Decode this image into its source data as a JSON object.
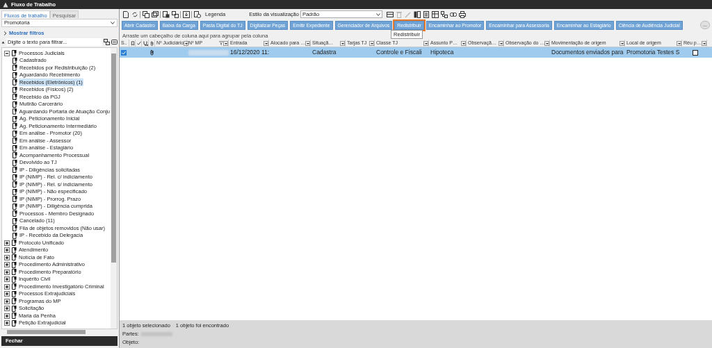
{
  "window": {
    "title": "Fluxo de Trabalho"
  },
  "left_panel": {
    "tabs": [
      {
        "label": "Fluxos de trabalho",
        "selected": true
      },
      {
        "label": "Pesquisar",
        "selected": false
      }
    ],
    "flow_select": {
      "value": "Promotoria"
    },
    "filters_toggle": {
      "label": "Mostrar filtros",
      "expanded": false
    },
    "filter_field": {
      "placeholder": "Digite o texto para filtrar..."
    },
    "tree": [
      {
        "label": "Processos Judiciais",
        "expanded": true,
        "selected": false,
        "children": [
          {
            "label": "Cadastrado",
            "selected": false
          },
          {
            "label": "Recebidos por Redistribuição (2)",
            "selected": false
          },
          {
            "label": "Aguardando Recebimento",
            "selected": false
          },
          {
            "label": "Recebidos (Eletrônicos) (1)",
            "selected": true
          },
          {
            "label": "Recebidos (Físicos) (2)",
            "selected": false
          },
          {
            "label": "Recebido da PGJ",
            "selected": false
          },
          {
            "label": "Mutirão Carcerário",
            "selected": false
          },
          {
            "label": "Aguardando Portaria de Atuação Conju",
            "selected": false
          },
          {
            "label": "Ag. Peticionamento Inicial",
            "selected": false
          },
          {
            "label": "Ag. Peticionamento Intermediário",
            "selected": false
          },
          {
            "label": "Em análise - Promotor (20)",
            "selected": false
          },
          {
            "label": "Em análise - Assessor",
            "selected": false
          },
          {
            "label": "Em análise - Estagiário",
            "selected": false
          },
          {
            "label": "Acompanhamento Processual",
            "selected": false
          },
          {
            "label": "Devolvido ao TJ",
            "selected": false
          },
          {
            "label": "IP - Diligências solicitadas",
            "selected": false
          },
          {
            "label": "IP (NIMP) - Rel. c/ indiciamento",
            "selected": false
          },
          {
            "label": "IP (NIMP) - Rel. s/ indiciamento",
            "selected": false
          },
          {
            "label": "IP (NIMP) - Não especificado",
            "selected": false
          },
          {
            "label": "IP (NIMP) - Prorrog. Prazo",
            "selected": false
          },
          {
            "label": "IP (NIMP) - Diligência cumprida",
            "selected": false
          },
          {
            "label": "Processos - Membro Designado",
            "selected": false
          },
          {
            "label": "Cancelado (11)",
            "selected": false
          },
          {
            "label": "Fila de objetos removidos (Não usar)",
            "selected": false
          },
          {
            "label": "IP - Recebido da Delegacia",
            "selected": false
          }
        ]
      },
      {
        "label": "Protocolo Unificado",
        "expanded": false,
        "selected": false
      },
      {
        "label": "Atendimento",
        "expanded": false,
        "selected": false
      },
      {
        "label": "Notícia de Fato",
        "expanded": false,
        "selected": false
      },
      {
        "label": "Procedimento Administrativo",
        "expanded": false,
        "selected": false
      },
      {
        "label": "Procedimento Preparatório",
        "expanded": false,
        "selected": false
      },
      {
        "label": "Inquérito Civil",
        "expanded": false,
        "selected": false
      },
      {
        "label": "Procedimento Investigatório Criminal",
        "expanded": false,
        "selected": false
      },
      {
        "label": "Processos Extrajudiciais",
        "expanded": false,
        "selected": false
      },
      {
        "label": "Programas do MP",
        "expanded": false,
        "selected": false
      },
      {
        "label": "Solicitação",
        "expanded": false,
        "selected": false
      },
      {
        "label": "Maria da Penha",
        "expanded": false,
        "selected": false
      },
      {
        "label": "Petição Extrajudicial",
        "expanded": false,
        "selected": false
      }
    ],
    "close_button": "Fechar"
  },
  "toolbar": {
    "legend_label": "Legenda",
    "view_style_label": "Estilo da visualização",
    "view_style": {
      "value": "Padrão"
    },
    "right_tools": [
      {
        "kind": "layout",
        "disabled": false
      },
      {
        "kind": "delete",
        "disabled": true
      },
      {
        "kind": "edit",
        "disabled": true
      },
      {
        "kind": "columns",
        "disabled": false
      },
      {
        "kind": "doc",
        "disabled": false
      },
      {
        "kind": "grid",
        "disabled": false
      },
      {
        "kind": "tree",
        "disabled": false
      },
      {
        "kind": "link",
        "disabled": false
      },
      {
        "kind": "print",
        "disabled": false
      }
    ]
  },
  "actions": [
    {
      "label": "Abrir Cadastro",
      "focused": false
    },
    {
      "label": "Baixa da Carga",
      "focused": false
    },
    {
      "label": "Pasta Digital do TJ",
      "focused": false
    },
    {
      "label": "Digitalizar Peças",
      "focused": false
    },
    {
      "label": "Emitir Expediente",
      "focused": false
    },
    {
      "label": "Gerenciador de Arquivos",
      "focused": false
    },
    {
      "label": "Redistribuir",
      "focused": true
    },
    {
      "label": "Encaminhar ao Promotor",
      "focused": false
    },
    {
      "label": "Encaminhar para Assessoria",
      "focused": false
    },
    {
      "label": "Encaminhar ao Estagiário",
      "focused": false
    },
    {
      "label": "Ciência de Audiência Judicial",
      "focused": false
    }
  ],
  "more_button": "...",
  "tooltip": "Redistribuir",
  "group_hint": "Arraste um cabeçalho de coluna aqui para agrupar pela coluna",
  "table": {
    "columns": [
      {
        "kind": "text",
        "label": "S.."
      },
      {
        "kind": "bookmark"
      },
      {
        "kind": "check"
      },
      {
        "kind": "stethoscope"
      },
      {
        "kind": "clip"
      },
      {
        "kind": "text",
        "label": "Nº Judiciário"
      },
      {
        "kind": "text",
        "label": "Nº MP",
        "filtered": true
      },
      {
        "kind": "text",
        "label": "Entrada"
      },
      {
        "kind": "text",
        "label": "Alocado para …"
      },
      {
        "kind": "text",
        "label": "Situaçã…"
      },
      {
        "kind": "text",
        "label": "Tarjas TJ"
      },
      {
        "kind": "text",
        "label": "Classe TJ"
      },
      {
        "kind": "text",
        "label": "Assunto P…"
      },
      {
        "kind": "text",
        "label": "Observaçã…"
      },
      {
        "kind": "text",
        "label": "Observação do …"
      },
      {
        "kind": "text",
        "label": "Movimentação de origem"
      },
      {
        "kind": "text",
        "label": "Local de origem"
      },
      {
        "kind": "text",
        "label": "Réu p…"
      }
    ],
    "rows": [
      {
        "selected": true,
        "checked": true,
        "attachment": true,
        "mp_blurred": true,
        "reu_preso": false,
        "cells": [
          "",
          "",
          "",
          "",
          "",
          "",
          "",
          "16/12/2020 11:",
          "",
          "Cadastra",
          "",
          "Controle e Fiscali",
          "Hipoteca",
          "",
          "",
          "Documentos enviados para",
          "Promotoria Testes S",
          ""
        ]
      }
    ]
  },
  "status_bar": {
    "selection": "1 objeto selecionado",
    "found": "1 objeto foi encontrado",
    "parts_label": "Partes:",
    "parts_blurred": true,
    "object_label": "Objeto:"
  }
}
